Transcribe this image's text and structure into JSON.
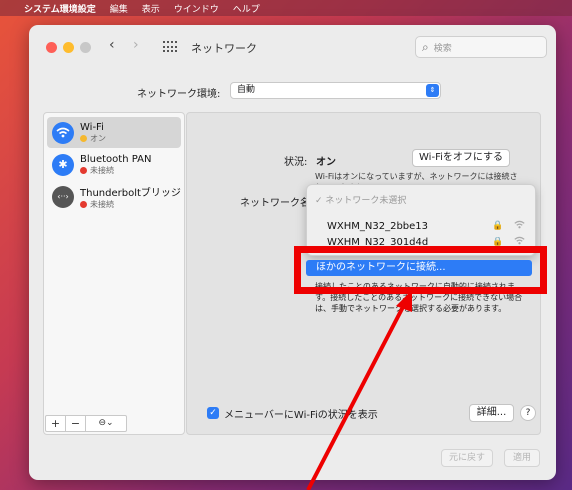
{
  "menubar": {
    "apple": "",
    "app": "システム環境設定",
    "items": [
      "編集",
      "表示",
      "ウインドウ",
      "ヘルプ"
    ]
  },
  "window": {
    "title": "ネットワーク",
    "search_placeholder": "検索"
  },
  "location": {
    "label": "ネットワーク環境:",
    "value": "自動"
  },
  "services": [
    {
      "name": "Wi-Fi",
      "status": "オン",
      "status_color": "#f5b82e",
      "icon": "wifi-icon",
      "selected": true
    },
    {
      "name": "Bluetooth PAN",
      "status": "未接続",
      "status_color": "#e43a2f",
      "icon": "bluetooth-icon",
      "selected": false
    },
    {
      "name": "Thunderboltブリッジ",
      "status": "未接続",
      "status_color": "#e43a2f",
      "icon": "thunderbolt-bridge-icon",
      "selected": false
    }
  ],
  "toolbar": {
    "add": "+",
    "remove": "−",
    "action": "⊖⌄"
  },
  "detail": {
    "status_label": "状況:",
    "status_value": "オン",
    "wifi_off_button": "Wi-Fiをオフにする",
    "status_description": "Wi-Fiはオンになっていますが、ネットワークには接続されていません。",
    "network_name_label": "ネットワーク名"
  },
  "network_dropdown": {
    "header": "✓ ネットワーク未選択",
    "networks": [
      {
        "ssid": "WXHM_N32_2bbe13",
        "lock": "🔒",
        "signal": "wifi-signal-icon"
      },
      {
        "ssid": "WXHM_N32_301d4d",
        "lock": "🔒",
        "signal": "wifi-signal-icon"
      }
    ],
    "join_other": "ほかのネットワークに接続...",
    "join_description": "接続したことのあるネットワークに自動的に接続されます。接続したことのあるネットワークに接続できない場合は、手動でネットワークを選択する必要があります。"
  },
  "footer": {
    "show_in_menubar": "メニューバーにWi-Fiの状況を表示",
    "show_in_menubar_checked": true,
    "advanced": "詳細...",
    "help": "?",
    "revert": "元に戻す",
    "apply": "適用"
  },
  "annotation": {
    "color": "#ee0000"
  }
}
